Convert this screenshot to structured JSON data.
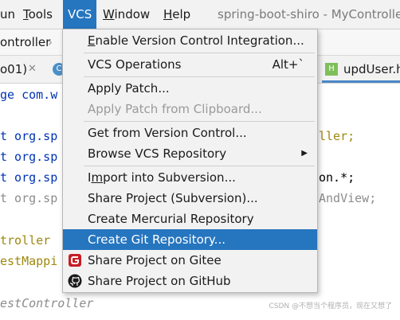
{
  "menubar": {
    "items": [
      {
        "prefix": "",
        "mnemonic": "",
        "rest": "un"
      },
      {
        "prefix": "",
        "mnemonic": "T",
        "rest": "ools"
      },
      {
        "prefix": "VCS",
        "mnemonic": "",
        "rest": ""
      },
      {
        "prefix": "",
        "mnemonic": "W",
        "rest": "indow"
      },
      {
        "prefix": "",
        "mnemonic": "H",
        "rest": "elp"
      }
    ],
    "window_title": "spring-boot-shiro - MyController"
  },
  "breadcrumb": {
    "item": "ontroller"
  },
  "tabs": [
    {
      "label": "o01)",
      "close": "✕",
      "icon": "class-icon"
    },
    {
      "label": "updUser.h",
      "icon": "html-icon"
    }
  ],
  "code": {
    "lines_left": [
      "ge com.w",
      "",
      "t org.sp",
      "t org.sp",
      "t org.sp",
      "t org.sp",
      "",
      "troller",
      "estMappi",
      "",
      "estController"
    ],
    "right_fragments": [
      "ller;",
      "on.*;",
      "AndView;"
    ]
  },
  "vcs_menu": {
    "items": [
      {
        "label": "Enable Version Control Integration...",
        "underline_index": 0,
        "state": "normal"
      },
      {
        "label": "VCS Operations",
        "shortcut": "Alt+`",
        "state": "normal"
      },
      {
        "label": "Apply Patch...",
        "state": "normal"
      },
      {
        "label": "Apply Patch from Clipboard...",
        "state": "disabled"
      },
      {
        "label": "Get from Version Control...",
        "state": "normal"
      },
      {
        "label": "Browse VCS Repository",
        "submenu": true,
        "state": "normal"
      },
      {
        "label": "Import into Subversion...",
        "underline_index": 1,
        "state": "normal"
      },
      {
        "label": "Share Project (Subversion)...",
        "state": "normal"
      },
      {
        "label": "Create Mercurial Repository",
        "state": "normal"
      },
      {
        "label": "Create Git Repository...",
        "state": "selected"
      },
      {
        "label": "Share Project on Gitee",
        "icon": "gitee-icon",
        "state": "normal"
      },
      {
        "label": "Share Project on GitHub",
        "icon": "github-icon",
        "state": "normal"
      }
    ]
  },
  "watermark": "CSDN @不想当个程序员，现在又想了",
  "colors": {
    "accent": "#2675bf",
    "menu_bg": "#f2f2f2",
    "keyword": "#0033b3",
    "annotation": "#9e880d",
    "gitee_red": "#c71d23"
  }
}
